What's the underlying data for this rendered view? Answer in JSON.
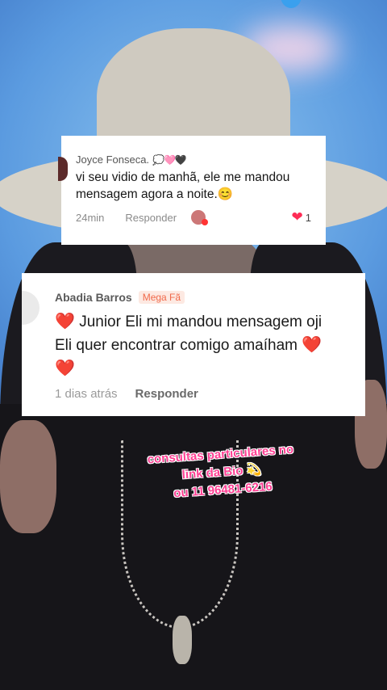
{
  "comment_top": {
    "author": "Joyce Fonseca.",
    "author_emoji": "💭🩷🖤",
    "text": "vi seu vidio de manhã, ele me mandou mensagem agora a noite.😊",
    "time": "24min",
    "reply_label": "Responder",
    "likes": "1"
  },
  "comment_main": {
    "author": "Abadia Barros",
    "badge": "Mega Fã",
    "heart_start": "❤️",
    "text_line1": "Junior Eli mi mandou mensagem oji",
    "text_line2": "Eli quer  encontrar comigo amaíham",
    "heart_end": "❤️",
    "heart_last": "❤️",
    "time": "1 dias atrás",
    "reply_label": "Responder"
  },
  "overlay": {
    "line1": "consultas particulares no",
    "line2": "link da Bio 💫",
    "line3": "ou 11 96481-6216"
  },
  "colors": {
    "like_heart": "#fe2c55",
    "badge_text": "#f06a4b",
    "overlay_text": "#ff3f93"
  }
}
